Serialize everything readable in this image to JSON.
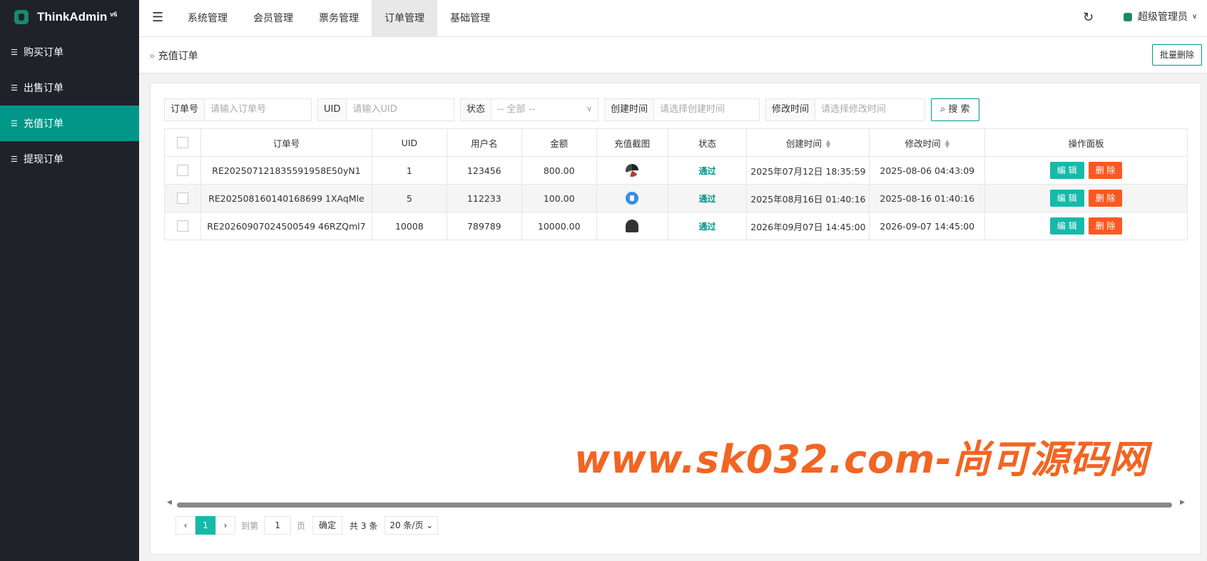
{
  "sidebar": {
    "logo": "ThinkAdmin",
    "version": "v6",
    "items": [
      {
        "label": "购买订单"
      },
      {
        "label": "出售订单"
      },
      {
        "label": "充值订单"
      },
      {
        "label": "提现订单"
      }
    ]
  },
  "topnav": {
    "items": [
      "系统管理",
      "会员管理",
      "票务管理",
      "订单管理",
      "基础管理"
    ],
    "user": "超级管理员"
  },
  "breadcrumb": {
    "title": "充值订单",
    "batch_delete": "批量删除"
  },
  "search": {
    "order_label": "订单号",
    "order_placeholder": "请输入订单号",
    "uid_label": "UID",
    "uid_placeholder": "请输入UID",
    "status_label": "状态",
    "status_value": "-- 全部 --",
    "ctime_label": "创建时间",
    "ctime_placeholder": "请选择创建时间",
    "mtime_label": "修改时间",
    "mtime_placeholder": "请选择修改时间",
    "button": "搜 索"
  },
  "table": {
    "headers": [
      "订单号",
      "UID",
      "用户名",
      "金额",
      "充值截图",
      "状态",
      "创建时间",
      "修改时间",
      "操作面板"
    ],
    "rows": [
      {
        "order": "RE202507121835591958E50yN1",
        "uid": "1",
        "user": "123456",
        "amount": "800.00",
        "status": "通过",
        "created": "2025年07月12日 18:35:59",
        "modified": "2025-08-06 04:43:09"
      },
      {
        "order": "RE202508160140168699 1XAqMle",
        "uid": "5",
        "user": "112233",
        "amount": "100.00",
        "status": "通过",
        "created": "2025年08月16日 01:40:16",
        "modified": "2025-08-16 01:40:16"
      },
      {
        "order": "RE20260907024500549 46RZQml7",
        "uid": "10008",
        "user": "789789",
        "amount": "10000.00",
        "status": "通过",
        "created": "2026年09月07日 14:45:00",
        "modified": "2026-09-07 14:45:00"
      }
    ],
    "edit": "编 辑",
    "delete": "删 除"
  },
  "pager": {
    "current": "1",
    "goto": "到第",
    "page_input": "1",
    "page_unit": "页",
    "confirm": "确定",
    "total": "共 3 条",
    "per_page": "20 条/页"
  },
  "watermark": "www.sk032.com-尚可源码网"
}
